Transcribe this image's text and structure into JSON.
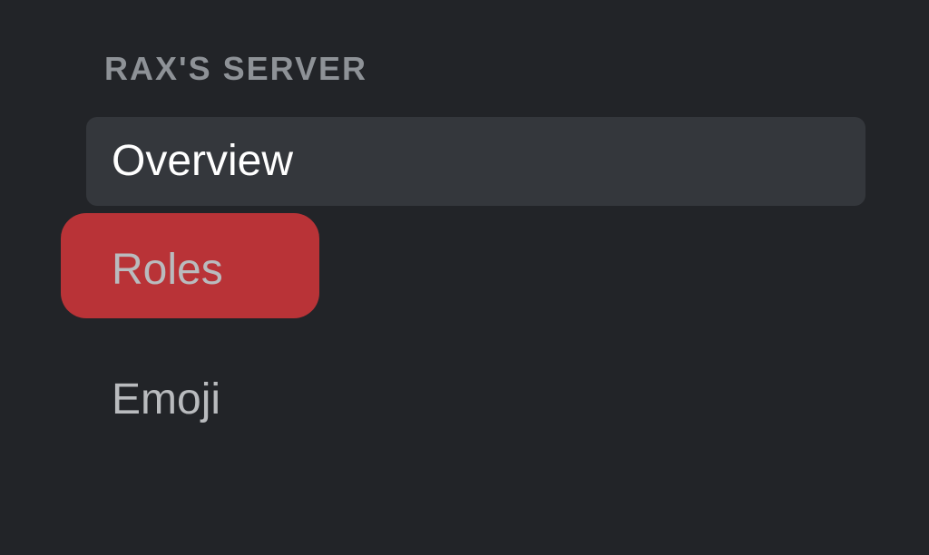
{
  "sidebar": {
    "header": "RAX'S SERVER",
    "items": [
      {
        "label": "Overview"
      },
      {
        "label": "Roles"
      },
      {
        "label": "Emoji"
      }
    ]
  }
}
